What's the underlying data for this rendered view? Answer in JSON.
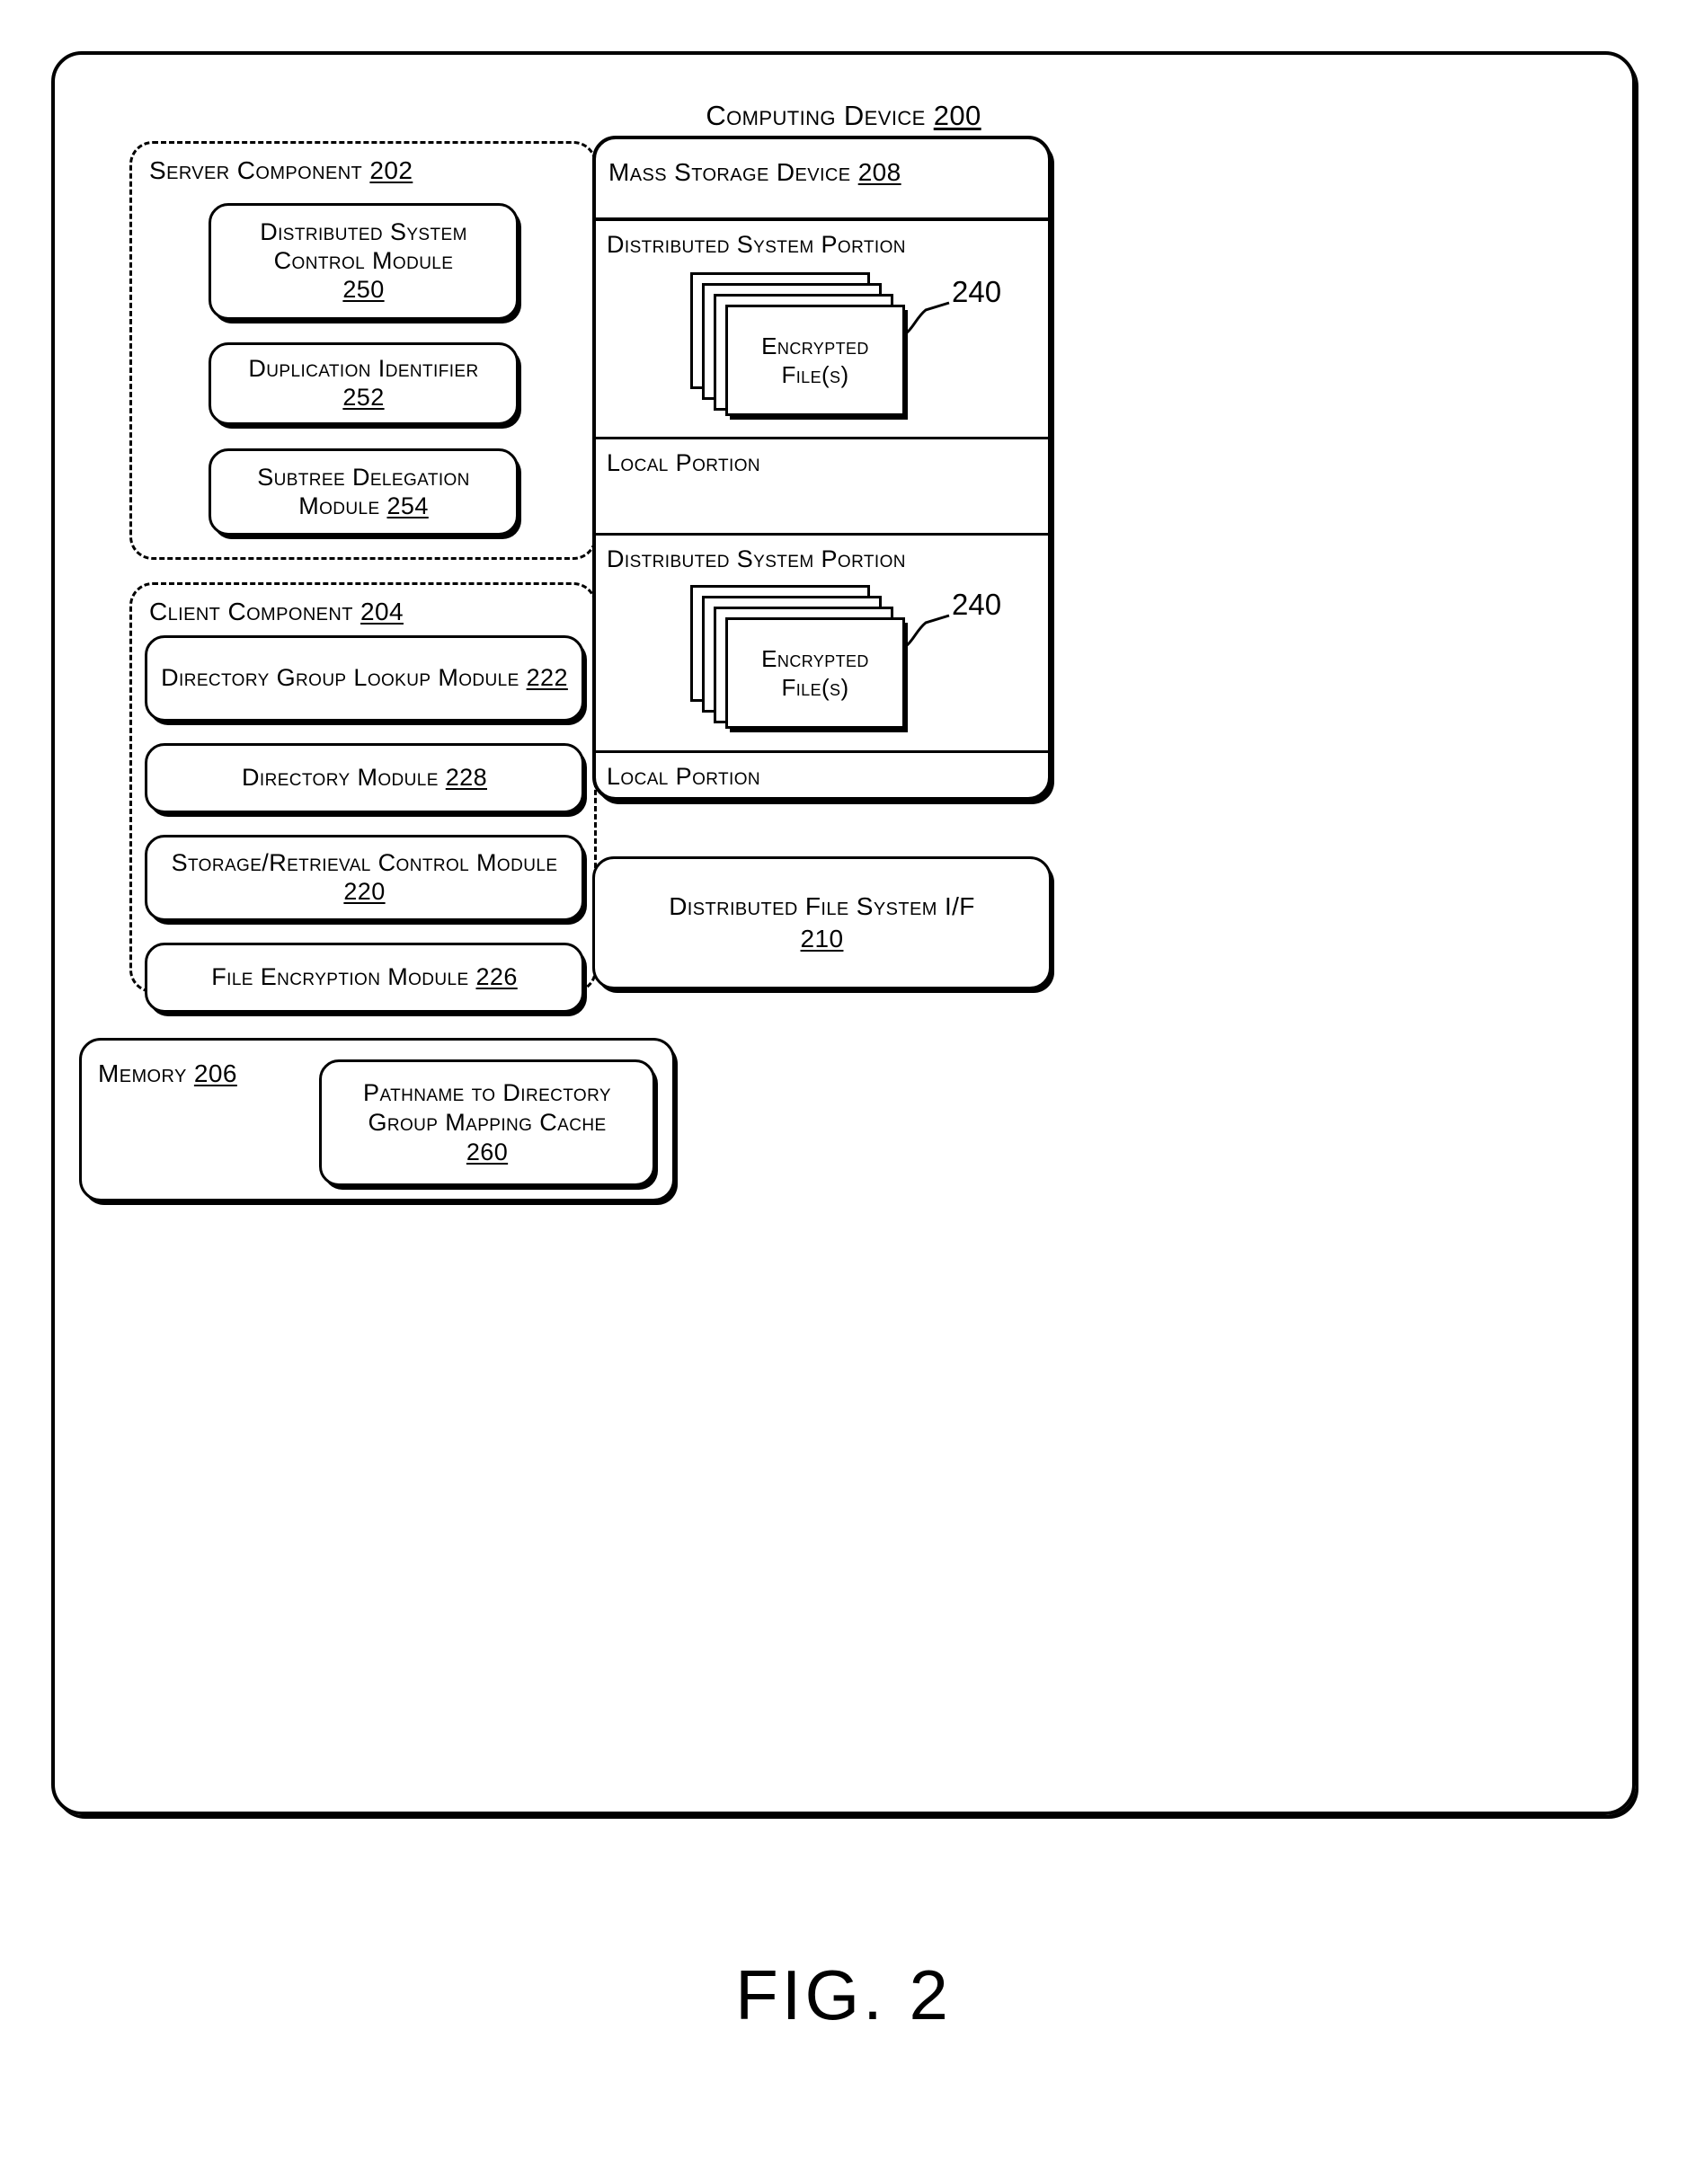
{
  "figure": {
    "caption": "FIG. 2"
  },
  "device": {
    "title": "Computing Device",
    "ref": "200"
  },
  "server_component": {
    "title": "Server Component",
    "ref": "202",
    "modules": [
      {
        "label": "Distributed System Control Module",
        "ref": "250",
        "ref_inline": false
      },
      {
        "label": "Duplication Identifier",
        "ref": "252",
        "ref_inline": false
      },
      {
        "label": "Subtree Delegation Module",
        "ref": "254",
        "ref_inline": true
      }
    ]
  },
  "client_component": {
    "title": "Client Component",
    "ref": "204",
    "modules": [
      {
        "label": "Directory Group Lookup Module",
        "ref": "222",
        "ref_inline": true
      },
      {
        "label": "Directory Module",
        "ref": "228",
        "ref_inline": true
      },
      {
        "label": "Storage/Retrieval Control Module",
        "ref": "220",
        "ref_inline": true
      },
      {
        "label": "File Encryption Module",
        "ref": "226",
        "ref_inline": true
      }
    ]
  },
  "memory": {
    "title": "Memory",
    "ref": "206",
    "cache": {
      "label": "Pathname to Directory Group Mapping Cache",
      "ref": "260"
    }
  },
  "mass_storage": {
    "title": "Mass Storage Device",
    "ref": "208",
    "sections": [
      {
        "label": "Distributed System Portion",
        "has_files": true
      },
      {
        "label": "Local Portion",
        "has_files": false
      },
      {
        "label": "Distributed System Portion",
        "has_files": true
      },
      {
        "label": "Local Portion",
        "has_files": false
      }
    ],
    "file_stack": {
      "label": "Encrypted File(s)",
      "ref": "240",
      "sheet_count": 4
    }
  },
  "dfs_interface": {
    "label": "Distributed File System I/F",
    "ref": "210"
  },
  "colors": {
    "ink": "#000000",
    "paper": "#ffffff"
  }
}
